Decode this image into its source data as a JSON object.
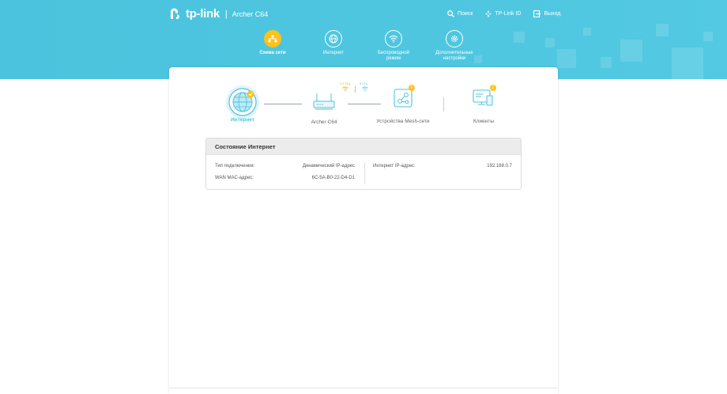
{
  "header": {
    "brand": "tp-link",
    "separator": "|",
    "model": "Archer C64",
    "links": [
      {
        "label": "Поиск",
        "icon": "search-icon"
      },
      {
        "label": "TP-Link ID",
        "icon": "user-key-icon"
      },
      {
        "label": "Выход",
        "icon": "logout-icon"
      }
    ]
  },
  "nav": {
    "tabs": [
      {
        "label": "Схема сети",
        "icon": "network-map-icon",
        "active": true
      },
      {
        "label": "Интернет",
        "icon": "globe-icon",
        "active": false
      },
      {
        "label": "Беспроводной режим",
        "line1": "Беспроводной",
        "line2": "режим",
        "icon": "wifi-icon",
        "active": false
      },
      {
        "label": "Дополнительные настройки",
        "line1": "Дополнительные",
        "line2": "настройки",
        "icon": "gear-icon",
        "active": false
      }
    ],
    "accent": "#ffc21a"
  },
  "topology": {
    "internet": {
      "label": "Интернет"
    },
    "router": {
      "label": "Archer C64",
      "band1": "2.4 ГГц",
      "band2": "5 ГГц"
    },
    "mesh": {
      "label": "Устройства Mesh-сети",
      "badge": "0"
    },
    "clients": {
      "label": "Клиенты",
      "badge": "2"
    }
  },
  "status": {
    "title": "Состояние Интернет",
    "connection_type_label": "Тип подключения:",
    "connection_type_value": "Динамический IP-адрес",
    "wan_mac_label": "WAN MAC-адрес:",
    "wan_mac_value": "6C-5A-B0-22-D4-D1",
    "internet_ip_label": "Интернет IP-адрес:",
    "internet_ip_value": "192.168.0.7"
  },
  "colors": {
    "banner": "#4ec6e0",
    "accent": "#ffc21a",
    "active_text": "#4cc3de"
  }
}
